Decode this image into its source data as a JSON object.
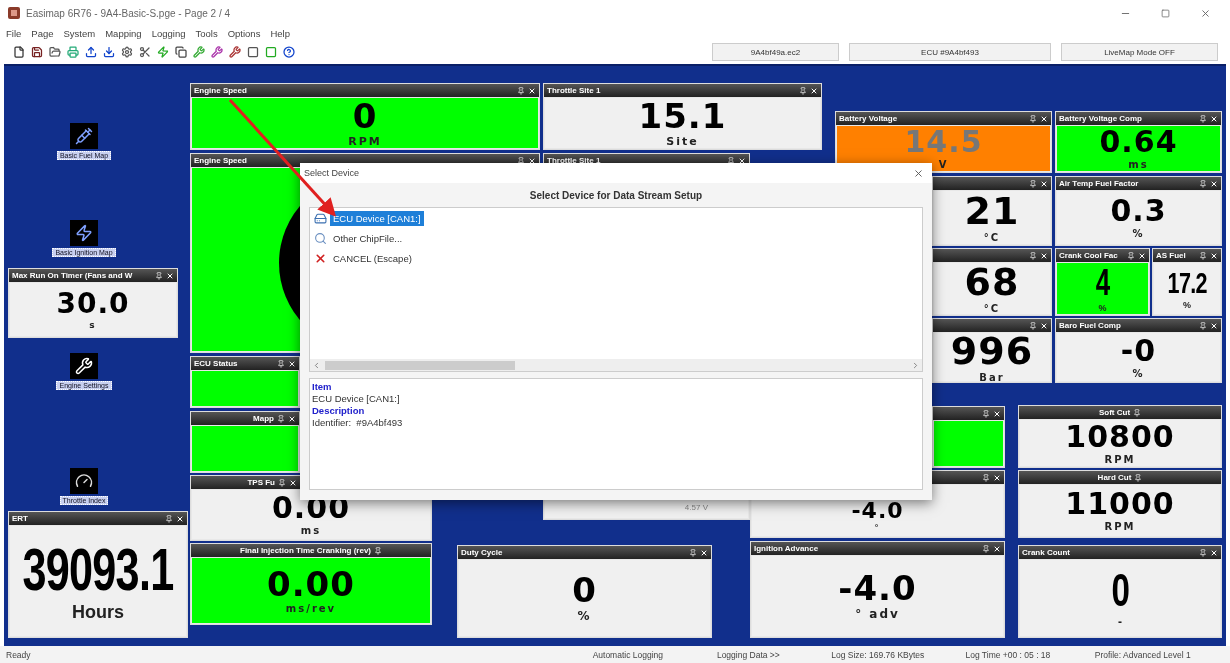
{
  "window": {
    "title": "Easimap 6R76 - 9A4-Basic-S.pge - Page 2 / 4"
  },
  "menu": [
    "File",
    "Page",
    "System",
    "Mapping",
    "Logging",
    "Tools",
    "Options",
    "Help"
  ],
  "toolbar_fields": [
    "9A4bf49a.ec2",
    "ECU #9A4bf493",
    "LiveMap Mode OFF"
  ],
  "desktop_icons": [
    {
      "kind": "fuel",
      "label": "Basic Fuel Map"
    },
    {
      "kind": "ignition",
      "label": "Basic Ignition Map"
    },
    {
      "kind": "settings",
      "label": "Engine Settings"
    },
    {
      "kind": "throttle",
      "label": "Throttle Index"
    }
  ],
  "gauges": [
    {
      "title": "Engine Speed",
      "value": "0",
      "unit": "RPM",
      "color": "#00ff00",
      "closable": true
    },
    {
      "title": "Throttle Site 1",
      "value": "15.1",
      "unit": "Site",
      "color": "#f0f0f0",
      "closable": true
    },
    {
      "kind": "dial",
      "title": "Engine Speed",
      "color": "#00ff00",
      "closable": true
    },
    {
      "kind": "small",
      "title": "Throttle Site 1",
      "value": "4.57 V",
      "color": "#f0f0f0",
      "closable": true
    },
    {
      "title": "Battery Voltage",
      "value": "14.5",
      "unit": "V",
      "color": "#ff8000",
      "closable": true
    },
    {
      "title": "Battery Voltage Comp",
      "value": "0.64",
      "unit": "ms",
      "color": "#00ff00",
      "closable": true
    },
    {
      "value": "21",
      "unit": "°C",
      "color": "#f0f0f0",
      "closable": true
    },
    {
      "value": "68",
      "unit": "°C",
      "color": "#f0f0f0",
      "closable": true
    },
    {
      "value": "996",
      "unit": "Bar",
      "color": "#f0f0f0",
      "closable": true
    },
    {
      "title": "Air Temp Fuel Factor",
      "value": "0.3",
      "unit": "%",
      "color": "#f0f0f0",
      "closable": true
    },
    {
      "title": "Crank Cool Fac",
      "value": "4",
      "unit": "%",
      "color": "#00ff00",
      "closable": true
    },
    {
      "title": "AS Fuel",
      "value": "17.2",
      "unit": "%",
      "color": "#f0f0f0",
      "closable": true
    },
    {
      "title": "Baro Fuel Comp",
      "value": "-0",
      "unit": "%",
      "color": "#f0f0f0",
      "closable": true
    },
    {
      "title": "Max Run On Timer (Fans and W",
      "value": "30.0",
      "unit": "s",
      "color": "#f0f0f0",
      "closable": true
    },
    {
      "title": "ECU Status",
      "color": "#00ff00",
      "closable": true
    },
    {
      "title": "Mapp",
      "color": "#00ff00",
      "closable": true
    },
    {
      "color": "#00ff00",
      "closable": true
    },
    {
      "title": "Soft Cut",
      "value": "10800",
      "unit": "RPM",
      "color": "#f0f0f0",
      "closable": false
    },
    {
      "title": "TPS Fu",
      "value": "0.00",
      "unit": "ms",
      "color": "#f0f0f0",
      "closable": true
    },
    {
      "value": "-4.0",
      "unit": "°",
      "color": "#f0f0f0",
      "closable": true
    },
    {
      "title": "Hard Cut",
      "value": "11000",
      "unit": "RPM",
      "color": "#f0f0f0",
      "closable": false
    },
    {
      "title": "ERT",
      "value": "39093.1",
      "unit": "Hours",
      "color": "#f0f0f0",
      "closable": true
    },
    {
      "title": "Final Injection Time Cranking (rev)",
      "value": "0.00",
      "unit": "ms/rev",
      "color": "#00ff00",
      "closable": false
    },
    {
      "title": "Duty Cycle",
      "value": "0",
      "unit": "%",
      "color": "#f0f0f0",
      "closable": true
    },
    {
      "title": "Ignition Advance",
      "value": "-4.0",
      "unit": "° adv",
      "color": "#f0f0f0",
      "closable": true
    },
    {
      "title": "Crank Count",
      "value": "0",
      "unit": "-",
      "color": "#f0f0f0",
      "closable": true
    }
  ],
  "dialog": {
    "title": "Select Device",
    "heading": "Select Device for Data Stream Setup",
    "items": [
      {
        "kind": "device",
        "label": "ECU Device [CAN1:]",
        "selected": true
      },
      {
        "kind": "search",
        "label": "Other ChipFile...",
        "selected": false
      },
      {
        "kind": "cancel",
        "label": "CANCEL (Escape)",
        "selected": false
      }
    ],
    "info": [
      {
        "kind": "heading",
        "text": "Item"
      },
      {
        "kind": "text",
        "text": "ECU Device [CAN1:]"
      },
      {
        "kind": "heading",
        "text": "Description"
      },
      {
        "kind": "text",
        "text": "Identifier:  #9A4bf493"
      }
    ]
  },
  "status_bar": [
    "Ready",
    "Automatic Logging",
    "Logging Data >>",
    "Log Size: 169.76 KBytes",
    "Log Time +00 : 05 : 18",
    "Profile: Advanced Level 1"
  ]
}
